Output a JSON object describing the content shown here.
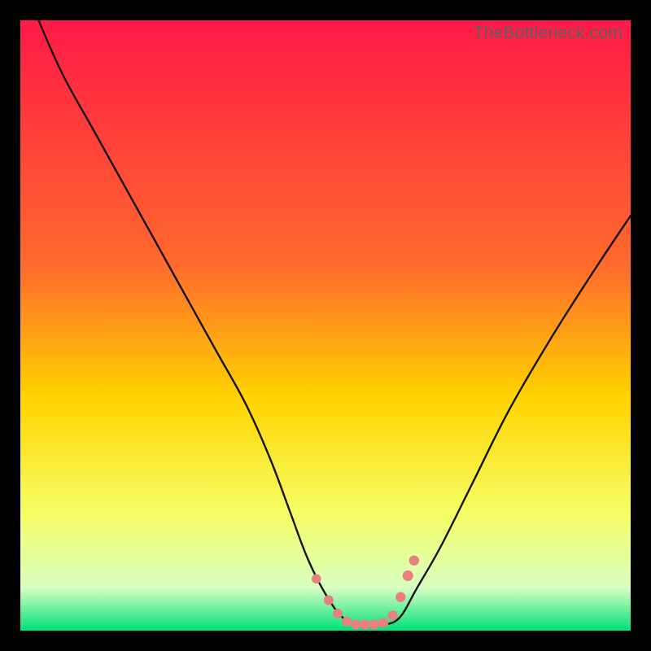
{
  "attribution": "TheBottleneck.com",
  "colors": {
    "top": "#ff1a47",
    "mid_upper": "#ff6a2d",
    "mid": "#ffd400",
    "mid_lower": "#f6ff66",
    "near_bottom": "#d8ffc2",
    "bottom": "#00e07a",
    "curve": "#151515",
    "marker": "#e98080"
  },
  "chart_data": {
    "type": "line",
    "title": "",
    "xlabel": "",
    "ylabel": "",
    "xlim": [
      0,
      100
    ],
    "ylim": [
      0,
      100
    ],
    "grid": false,
    "legend": false,
    "series": [
      {
        "name": "bottleneck-curve",
        "x": [
          0,
          3,
          7,
          12,
          17,
          22,
          27,
          32,
          37,
          41,
          44,
          47,
          50,
          53,
          56,
          59,
          62,
          65,
          69,
          74,
          80,
          87,
          94,
          100
        ],
        "y": [
          108,
          100,
          91,
          82,
          73,
          64,
          55,
          46,
          37,
          28,
          20,
          12,
          6,
          2,
          1,
          1,
          2,
          7,
          14,
          24,
          36,
          48,
          59,
          68
        ]
      }
    ],
    "markers": {
      "name": "highlight-dots",
      "x": [
        48.5,
        50.5,
        52.0,
        53.5,
        55.0,
        56.5,
        58.0,
        59.5,
        61.0,
        62.3,
        63.5,
        64.5
      ],
      "y": [
        8.5,
        5.0,
        2.8,
        1.5,
        1.0,
        1.0,
        1.0,
        1.3,
        2.5,
        5.5,
        9.0,
        11.5
      ],
      "r": [
        4.8,
        5.0,
        5.0,
        5.0,
        5.2,
        5.2,
        5.2,
        5.0,
        5.0,
        5.2,
        5.4,
        5.2
      ]
    },
    "gradient_stops": [
      {
        "pct": 0,
        "key": "top"
      },
      {
        "pct": 40,
        "key": "mid_upper"
      },
      {
        "pct": 62,
        "key": "mid"
      },
      {
        "pct": 81,
        "key": "mid_lower"
      },
      {
        "pct": 93,
        "key": "near_bottom"
      },
      {
        "pct": 100,
        "key": "bottom"
      }
    ]
  }
}
